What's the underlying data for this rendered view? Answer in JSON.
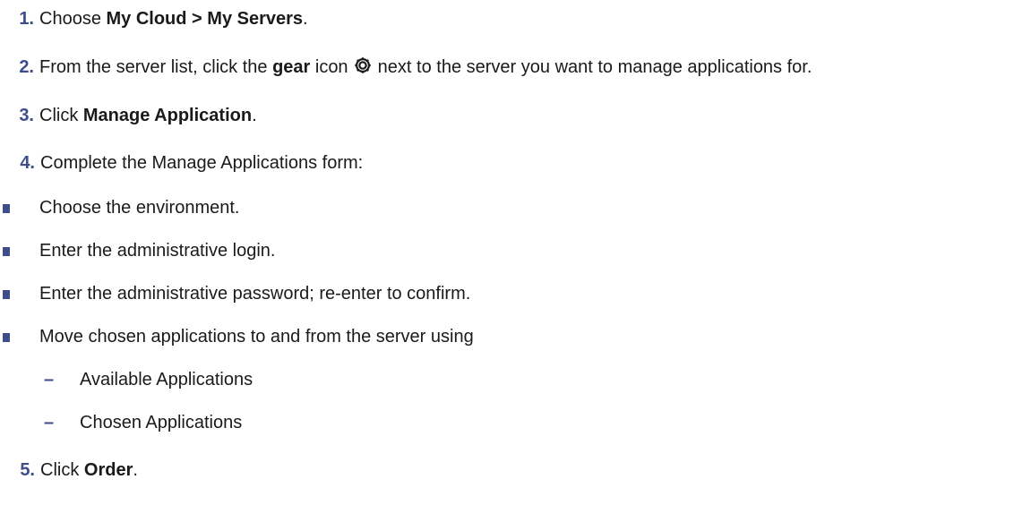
{
  "steps": [
    {
      "num": "1.",
      "pre": "Choose ",
      "bold": "My Cloud > My Servers",
      "post": "."
    },
    {
      "num": "2.",
      "pre": "From the server list, click the ",
      "bold": "gear",
      "mid": " icon ",
      "post": " next to the server you want to manage applications for.",
      "icon": "gear-icon"
    },
    {
      "num": "3.",
      "pre": "Click ",
      "bold": "Manage Application",
      "post": "."
    },
    {
      "num": "4.",
      "text": "Complete the Manage Applications form:"
    },
    {
      "num": "5.",
      "pre": "Click ",
      "bold": "Order",
      "post": "."
    }
  ],
  "bullets": [
    "Choose the environment.",
    "Enter the administrative login.",
    "Enter the administrative password; re-enter to confirm.",
    "Move chosen applications to and from the server using"
  ],
  "subitems": [
    {
      "dash": "–",
      "text": "Available Applications"
    },
    {
      "dash": "–",
      "text": "Chosen Applications"
    }
  ],
  "colors": {
    "accent": "#3d4d8a",
    "text": "#1a1a1a"
  }
}
